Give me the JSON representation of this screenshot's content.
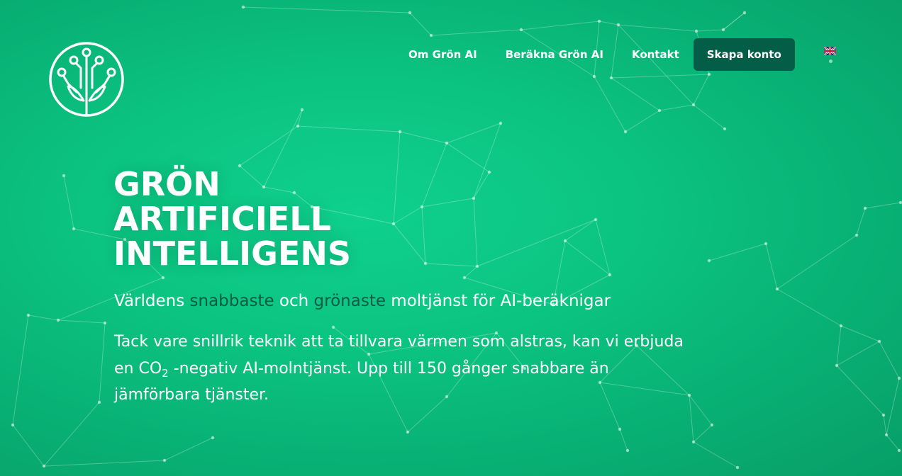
{
  "header": {
    "logo_name": "circuit-leaf-logo",
    "nav": [
      {
        "label": "Om Grön AI"
      },
      {
        "label": "Beräkna Grön AI"
      },
      {
        "label": "Kontakt"
      }
    ],
    "cta_label": "Skapa konto",
    "language_icon": "uk-flag-icon"
  },
  "hero": {
    "title_lines": [
      "GRÖN",
      "ARTIFICIELL",
      "INTELLIGENS"
    ],
    "subtitle": {
      "part1": "Världens ",
      "highlight1": "snabbaste",
      "part2": " och ",
      "highlight2": "grönaste",
      "part3": " moltjänst för AI-beräknigar"
    },
    "body": {
      "line1": "Tack vare snillrik teknik att ta tillvara värmen som alstras, kan vi erbjuda",
      "line2_pre": "en CO",
      "line2_sub": "2",
      "line2_post": " -negativ AI-molntjänst. Upp till 150 gånger snabbare än",
      "line3": "jämförbara tjänster."
    }
  },
  "colors": {
    "background": "#0cc482",
    "accent_dark": "#045e47",
    "highlight_text": "#0a5a44",
    "text": "#ffffff"
  }
}
